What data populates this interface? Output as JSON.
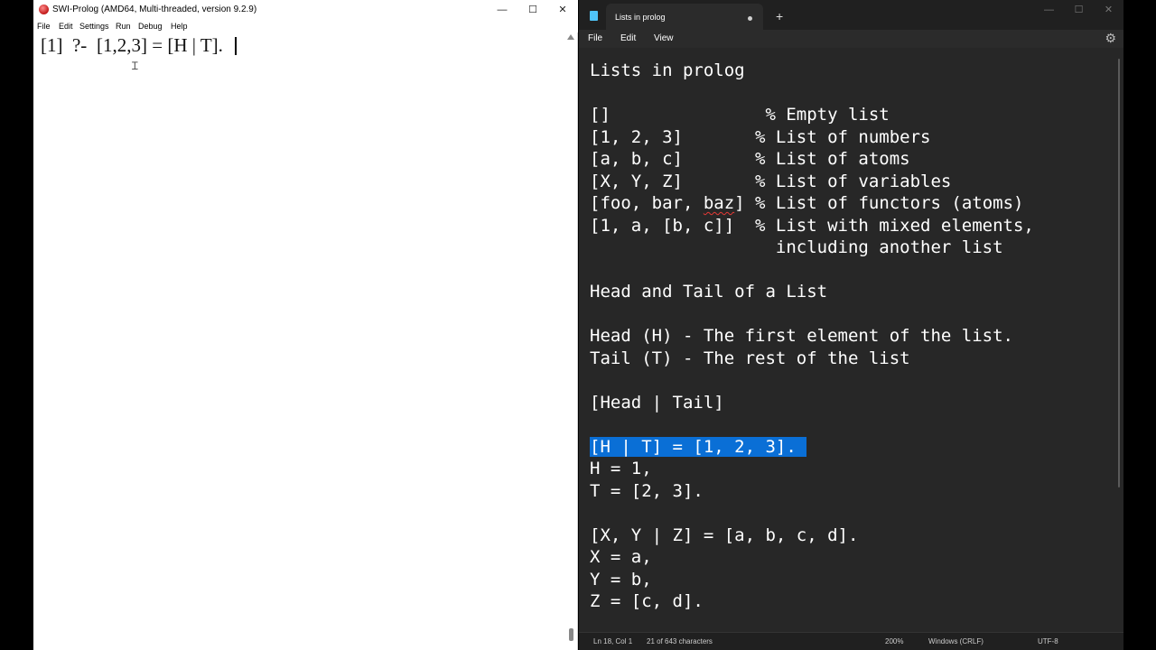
{
  "swi": {
    "title": "SWI-Prolog (AMD64, Multi-threaded, version 9.2.9)",
    "controls": {
      "minimize": "—",
      "maximize": "☐",
      "close": "✕"
    },
    "menu": [
      "File",
      "Edit",
      "Settings",
      "Run",
      "Debug",
      "Help"
    ],
    "console": {
      "prompt": "[1]  ?-",
      "query": "[1,2,3] = [H | T]."
    }
  },
  "notepad": {
    "tab_title": "Lists in prolog",
    "tab_status_dot": "●",
    "new_tab": "+",
    "controls": {
      "minimize": "—",
      "maximize": "☐",
      "close": "✕"
    },
    "menu": [
      "File",
      "Edit",
      "View"
    ],
    "settings_icon": "⚙",
    "lines": [
      "Lists in prolog",
      "",
      "[]               % Empty list",
      "[1, 2, 3]       % List of numbers",
      "[a, b, c]       % List of atoms",
      "[X, Y, Z]       % List of variables",
      "[foo, bar, baz] % List of functors (atoms)",
      "[1, a, [b, c]]  % List with mixed elements,",
      "                  including another list",
      "",
      "Head and Tail of a List",
      "",
      "Head (H) - The first element of the list.",
      "Tail (T) - The rest of the list",
      "",
      "[Head | Tail]",
      "",
      "[H | T] = [1, 2, 3].",
      "H = 1,",
      "T = [2, 3].",
      "",
      "[X, Y | Z] = [a, b, c, d].",
      "X = a,",
      "Y = b,",
      "Z = [c, d]."
    ],
    "selected_line_index": 17,
    "status": {
      "position": "Ln 18, Col 1",
      "characters": "21 of 643 characters",
      "zoom": "200%",
      "line_endings": "Windows (CRLF)",
      "encoding": "UTF-8"
    }
  },
  "colors": {
    "notepad_bg": "#272727",
    "selection": "#0a6fd6",
    "spell_underline": "#e53935"
  }
}
